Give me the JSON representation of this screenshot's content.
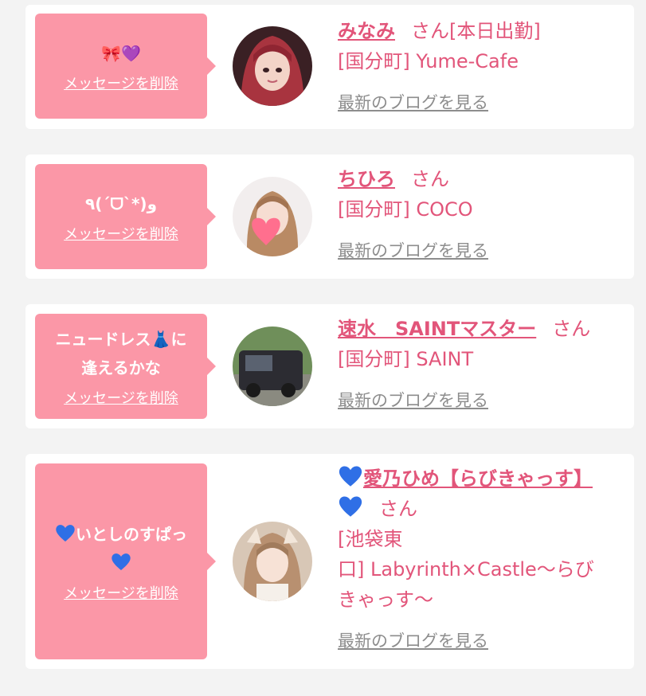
{
  "colors": {
    "bubble": "#fb97a7",
    "accent": "#e2557a",
    "blog_link": "#8d8d8d",
    "card": "#ffffff",
    "background": "#f3f3f3"
  },
  "delete_label": "メッセージを削除",
  "blog_label": "最新のブログを見る",
  "honorific": "さん",
  "cards": [
    {
      "message": "🎀💜",
      "name": "みなみ",
      "status": "[本日出勤]",
      "shop": "[国分町] Yume-Cafe",
      "avatar_icon": "avatar-photo"
    },
    {
      "message": "٩(ˊᗜˋ*)و",
      "name": "ちひろ",
      "status": "",
      "shop": "[国分町] COCO",
      "avatar_icon": "avatar-photo"
    },
    {
      "message_line1": "ニュードレス👗に",
      "message_line2": "逢えるかな",
      "name": "速水　SAINTマスター",
      "status": "",
      "shop": "[国分町] SAINT",
      "avatar_icon": "car-photo"
    },
    {
      "message_line1_text": "いとしのすぱっ",
      "message_heart_icon": "blue-heart-icon",
      "name": "愛乃ひめ【らびきゃっす】",
      "status": "",
      "shop_line1": "[池袋東",
      "shop_line2": "口] Labyrinth×Castle〜らび",
      "shop_line3": "きゃっす〜",
      "avatar_icon": "avatar-photo"
    }
  ]
}
